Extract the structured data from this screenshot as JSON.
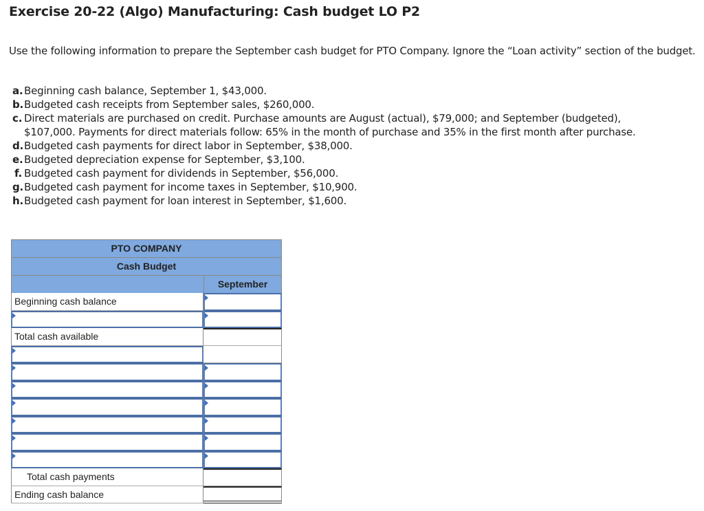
{
  "title": "Exercise 20-22 (Algo) Manufacturing: Cash budget LO P2",
  "intro": "Use the following information to prepare the September cash budget for PTO Company. Ignore the “Loan activity” section of the budget.",
  "items": [
    {
      "label": "a.",
      "text": "Beginning cash balance, September 1, $43,000."
    },
    {
      "label": "b.",
      "text": "Budgeted cash receipts from September sales, $260,000."
    },
    {
      "label": "c.",
      "text": "Direct materials are purchased on credit. Purchase amounts are August (actual), $79,000; and September (budgeted), $107,000. Payments for direct materials follow: 65% in the month of purchase and 35% in the first month after purchase."
    },
    {
      "label": "d.",
      "text": "Budgeted cash payments for direct labor in September, $38,000."
    },
    {
      "label": "e.",
      "text": "Budgeted depreciation expense for September, $3,100."
    },
    {
      "label": "f.",
      "text": "Budgeted cash payment for dividends in September, $56,000."
    },
    {
      "label": "g.",
      "text": "Budgeted cash payment for income taxes in September, $10,900."
    },
    {
      "label": "h.",
      "text": "Budgeted cash payment for loan interest in September, $1,600."
    }
  ],
  "budget": {
    "company": "PTO COMPANY",
    "title": "Cash Budget",
    "column": "September",
    "rows": {
      "beginning": "Beginning cash balance",
      "total_available": "Total cash available",
      "total_payments": "Total cash payments",
      "ending": "Ending cash balance"
    },
    "inputs": {
      "receipt_label": "",
      "receipt_value": "",
      "beginning_value": "",
      "payment_labels": [
        "",
        "",
        "",
        "",
        "",
        "",
        ""
      ],
      "payment_values": [
        "",
        "",
        "",
        "",
        "",
        ""
      ]
    }
  }
}
